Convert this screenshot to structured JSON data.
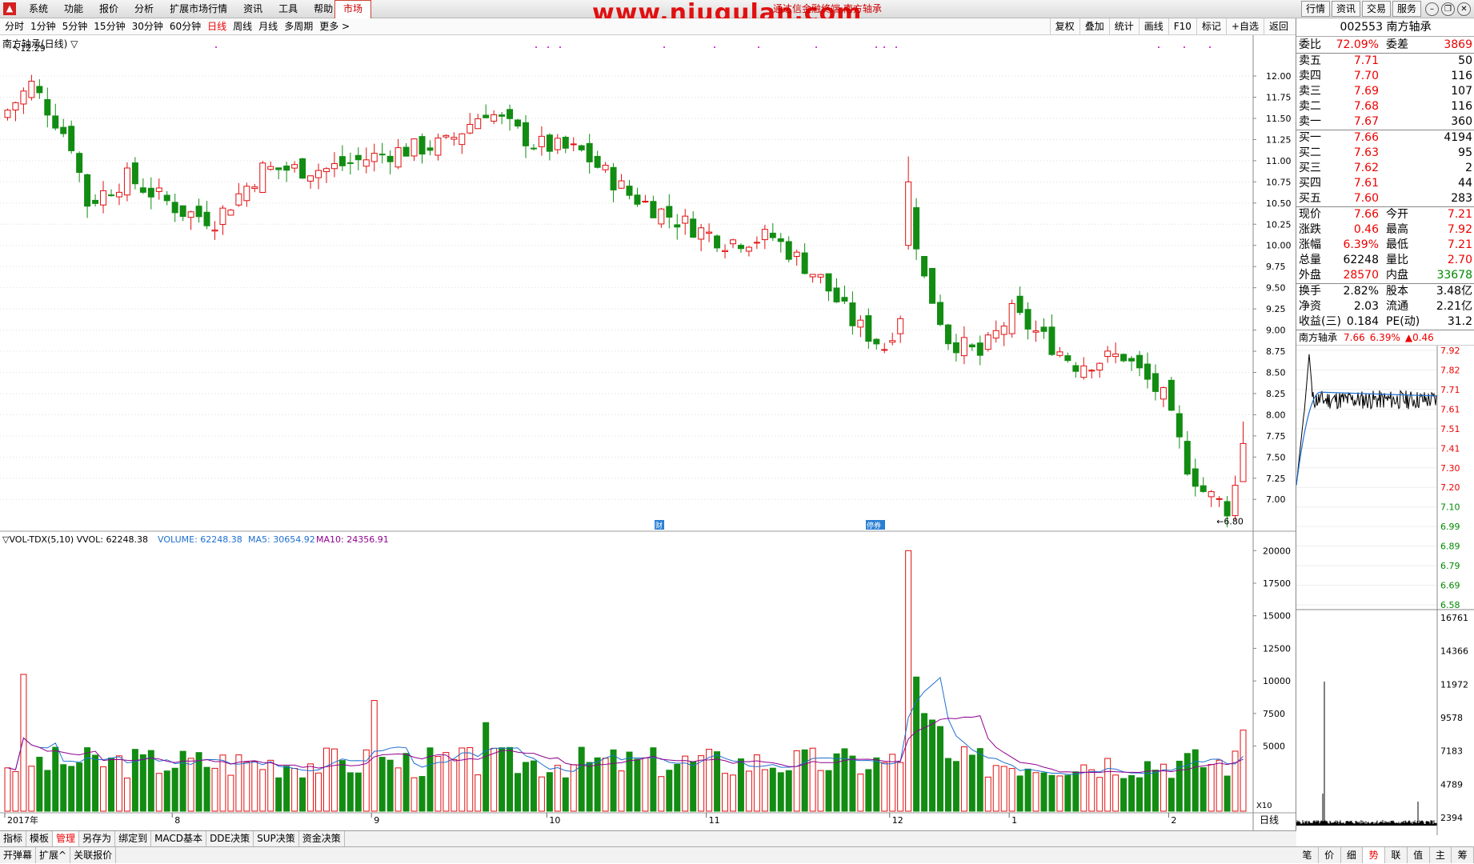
{
  "menu": {
    "logo": "▲",
    "items": [
      "系统",
      "功能",
      "报价",
      "分析",
      "扩展市场行情",
      "资讯",
      "工具",
      "帮助"
    ],
    "market": "市场",
    "watermark": "www.niugulan.com",
    "watermark_sub": "通达信金融终端 南方轴承",
    "right_buttons": [
      "行情",
      "资讯",
      "交易",
      "服务"
    ],
    "win_buttons": [
      "–",
      "❐",
      "✕"
    ]
  },
  "periodbar": {
    "periods": [
      "分时",
      "1分钟",
      "5分钟",
      "15分钟",
      "30分钟",
      "60分钟",
      "日线",
      "周线",
      "月线",
      "多周期",
      "更多 >"
    ],
    "active": "日线",
    "tools": [
      "复权",
      "叠加",
      "统计",
      "画线",
      "F10",
      "标记",
      "+自选",
      "返回"
    ]
  },
  "chart": {
    "title": "南方轴承(日线) ▽",
    "high_label": "12.29",
    "low_label": "6.80",
    "markers": [
      "财",
      "停券"
    ],
    "vol_title": "▽VOL-TDX(5,10) VVOL: 62248.38",
    "vol_volume": "VOLUME: 62248.38",
    "vol_ma5": "MA5: 30654.92",
    "vol_ma10": "MA10: 24356.91",
    "x10": "X10",
    "day_label": "日线",
    "month_labels": [
      "2017年",
      "8",
      "9",
      "10",
      "11",
      "12",
      "1",
      "2"
    ]
  },
  "chart_data": {
    "type": "candlestick",
    "price_ticks": [
      "12.00",
      "11.75",
      "11.50",
      "11.25",
      "11.00",
      "10.75",
      "10.50",
      "10.25",
      "10.00",
      "9.75",
      "9.50",
      "9.25",
      "9.00",
      "8.75",
      "8.50",
      "8.25",
      "8.00",
      "7.75",
      "7.50",
      "7.25",
      "7.00"
    ],
    "ylim": [
      6.7,
      12.35
    ],
    "vol_ticks": [
      "20000",
      "17500",
      "15000",
      "12500",
      "10000",
      "7500",
      "5000"
    ],
    "vol_ylim": [
      0,
      21000
    ],
    "last_price": 7.66,
    "last_volume": 62248.38,
    "ma5": 30654.92,
    "ma10": 24356.91
  },
  "quote": {
    "code_name": "002553 南方轴承",
    "weibi_label": "委比",
    "weibi": "72.09%",
    "weicha_label": "委差",
    "weicha": "3869",
    "asks": [
      {
        "label": "卖五",
        "price": "7.71",
        "vol": "50"
      },
      {
        "label": "卖四",
        "price": "7.70",
        "vol": "116"
      },
      {
        "label": "卖三",
        "price": "7.69",
        "vol": "107"
      },
      {
        "label": "卖二",
        "price": "7.68",
        "vol": "116"
      },
      {
        "label": "卖一",
        "price": "7.67",
        "vol": "360"
      }
    ],
    "bids": [
      {
        "label": "买一",
        "price": "7.66",
        "vol": "4194"
      },
      {
        "label": "买二",
        "price": "7.63",
        "vol": "95"
      },
      {
        "label": "买三",
        "price": "7.62",
        "vol": "2"
      },
      {
        "label": "买四",
        "price": "7.61",
        "vol": "44"
      },
      {
        "label": "买五",
        "price": "7.60",
        "vol": "283"
      }
    ],
    "stats": [
      {
        "l1": "现价",
        "v1": "7.66",
        "c1": "red",
        "l2": "今开",
        "v2": "7.21",
        "c2": "red"
      },
      {
        "l1": "涨跌",
        "v1": "0.46",
        "c1": "red",
        "l2": "最高",
        "v2": "7.92",
        "c2": "red"
      },
      {
        "l1": "涨幅",
        "v1": "6.39%",
        "c1": "red",
        "l2": "最低",
        "v2": "7.21",
        "c2": "red"
      },
      {
        "l1": "总量",
        "v1": "62248",
        "c1": "",
        "l2": "量比",
        "v2": "2.70",
        "c2": "red"
      },
      {
        "l1": "外盘",
        "v1": "28570",
        "c1": "red",
        "l2": "内盘",
        "v2": "33678",
        "c2": "green"
      }
    ],
    "stats2": [
      {
        "l1": "换手",
        "v1": "2.82%",
        "l2": "股本",
        "v2": "3.48亿"
      },
      {
        "l1": "净资",
        "v1": "2.03",
        "l2": "流通",
        "v2": "2.21亿"
      },
      {
        "l1": "收益(三)",
        "v1": "0.184",
        "l2": "PE(动)",
        "v2": "31.2"
      }
    ],
    "mini_title": "南方轴承",
    "mini_price": "7.66",
    "mini_pct": "6.39%",
    "mini_chg": "▲0.46",
    "mini_ticks_left": [
      "7.92",
      "7.82",
      "7.71",
      "7.61",
      "7.51",
      "7.41",
      "7.30",
      "7.20",
      "7.10",
      "6.99",
      "6.89",
      "6.79",
      "6.69",
      "6.58"
    ],
    "mini_vol_ticks": [
      "16761",
      "14366",
      "11972",
      "9578",
      "7183",
      "4789",
      "2394"
    ]
  },
  "bottom_tabs": [
    "指标",
    "模板",
    "管理",
    "另存为",
    "绑定到",
    "MACD基本",
    "DDE决策",
    "SUP决策",
    "资金决策"
  ],
  "bottom_active": "管理",
  "bottom_tabs2": [
    "开弹幕",
    "扩展^",
    "关联报价"
  ],
  "right_bottom_tabs": [
    "笔",
    "价",
    "细",
    "势",
    "联",
    "值",
    "主",
    "筹"
  ],
  "right_bottom_active": "势"
}
